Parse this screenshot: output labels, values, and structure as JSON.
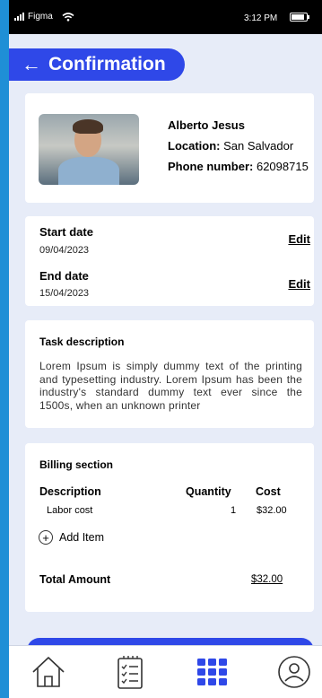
{
  "status_bar": {
    "carrier": "Figma",
    "time": "3:12 PM"
  },
  "header": {
    "title": "Confirmation",
    "back_icon": "back-arrow-icon"
  },
  "profile": {
    "name": "Alberto Jesus",
    "location_label": "Location:",
    "location_value": "San Salvador",
    "phone_label": "Phone number:",
    "phone_value": "62098715"
  },
  "dates": {
    "start_label": "Start date",
    "start_value": "09/04/2023",
    "end_label": "End date",
    "end_value": "15/04/2023",
    "edit_label": "Edit"
  },
  "task": {
    "title": "Task description",
    "text": "Lorem Ipsum is simply dummy text of the printing and typesetting industry. Lorem Ipsum has been the industry's standard dummy text ever since the 1500s, when an unknown printer"
  },
  "billing": {
    "title": "Billing section",
    "columns": [
      "Description",
      "Quantity",
      "Cost"
    ],
    "rows": [
      {
        "description": "Labor cost",
        "quantity": "1",
        "cost": "$32.00"
      }
    ],
    "add_item_label": "Add Item",
    "total_label": "Total Amount",
    "total_value": "$32.00"
  },
  "nav": {
    "items": [
      {
        "icon": "home-icon"
      },
      {
        "icon": "checklist-icon"
      },
      {
        "icon": "grid-icon",
        "active": true
      },
      {
        "icon": "profile-icon"
      }
    ]
  },
  "colors": {
    "accent": "#2f48e8",
    "background": "#e7ecf8",
    "frame": "#1f8fd6"
  }
}
